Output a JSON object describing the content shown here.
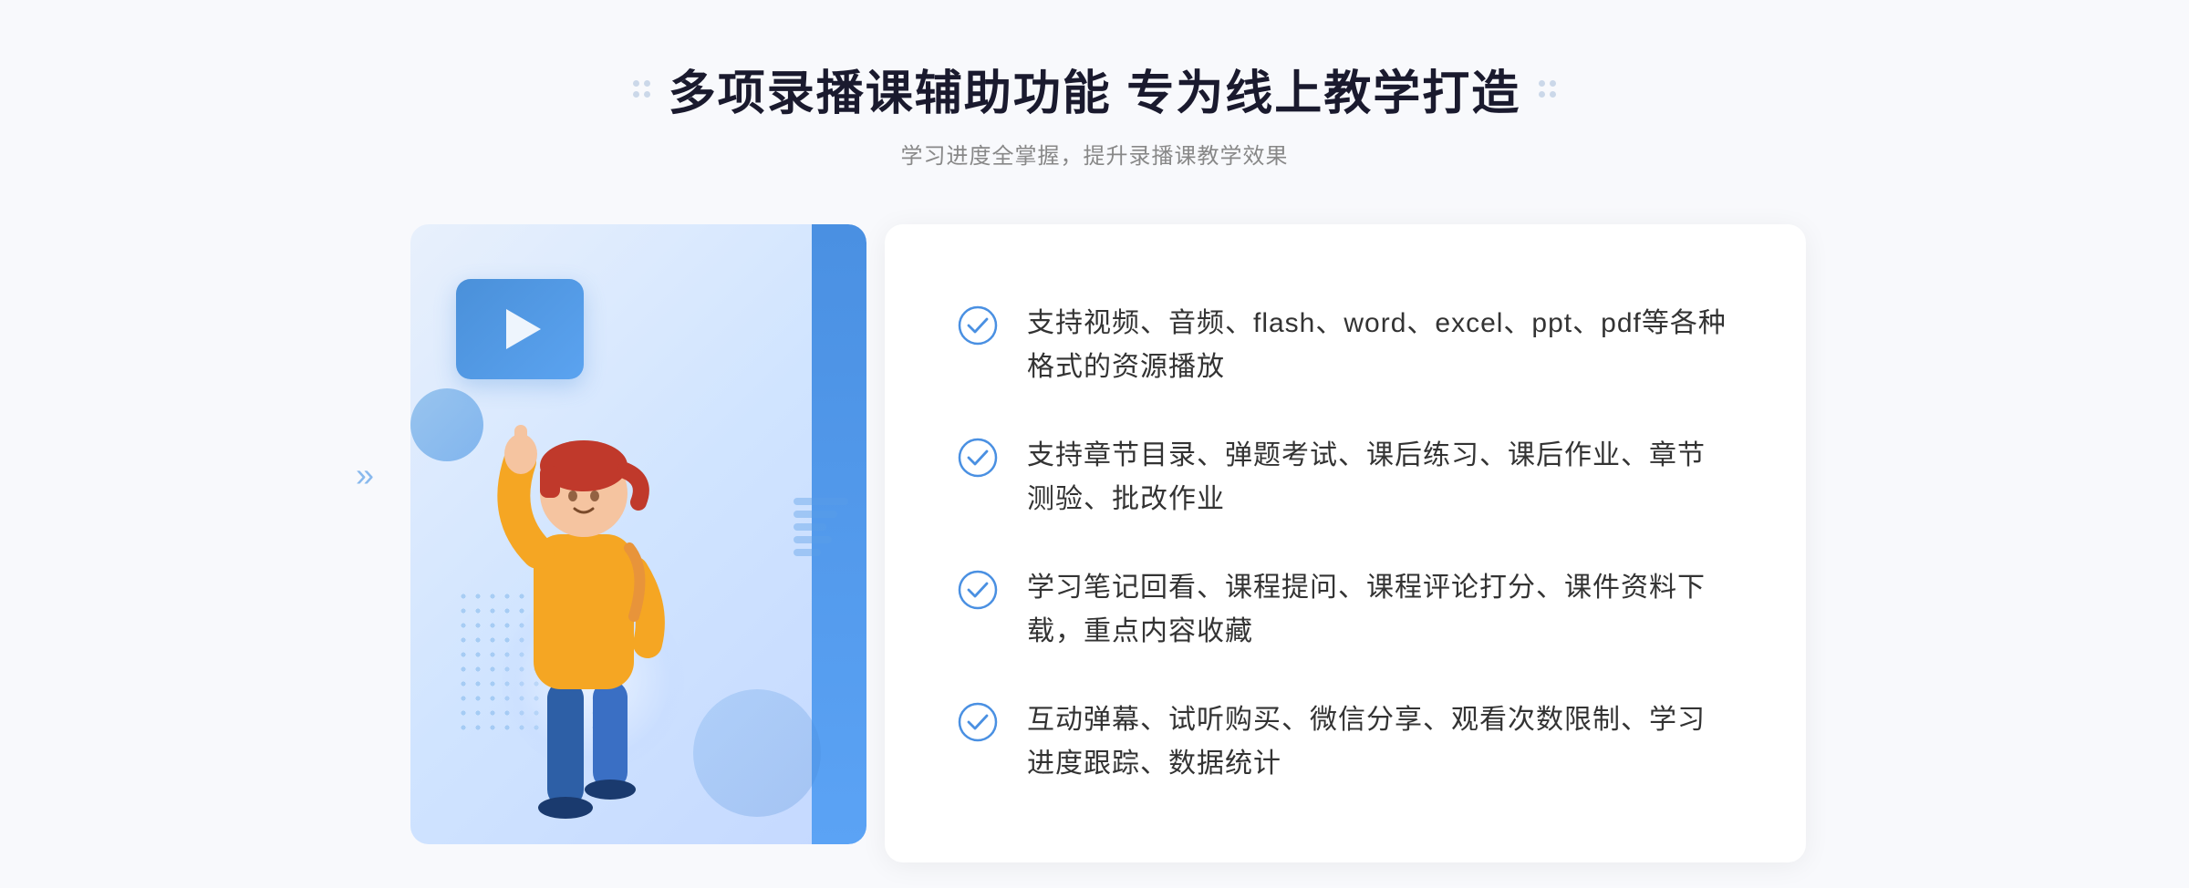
{
  "header": {
    "title": "多项录播课辅助功能 专为线上教学打造",
    "subtitle": "学习进度全掌握，提升录播课教学效果",
    "left_dots": "⁘",
    "right_dots": "⁘"
  },
  "features": [
    {
      "id": 1,
      "text": "支持视频、音频、flash、word、excel、ppt、pdf等各种格式的资源播放"
    },
    {
      "id": 2,
      "text": "支持章节目录、弹题考试、课后练习、课后作业、章节测验、批改作业"
    },
    {
      "id": 3,
      "text": "学习笔记回看、课程提问、课程评论打分、课件资料下载，重点内容收藏"
    },
    {
      "id": 4,
      "text": "互动弹幕、试听购买、微信分享、观看次数限制、学习进度跟踪、数据统计"
    }
  ],
  "colors": {
    "primary_blue": "#4a90e2",
    "light_blue": "#5ba3f5",
    "text_dark": "#1a1a2e",
    "text_medium": "#333333",
    "text_light": "#888888",
    "bg_light": "#f8f9fc",
    "check_blue": "#4a90e2"
  }
}
